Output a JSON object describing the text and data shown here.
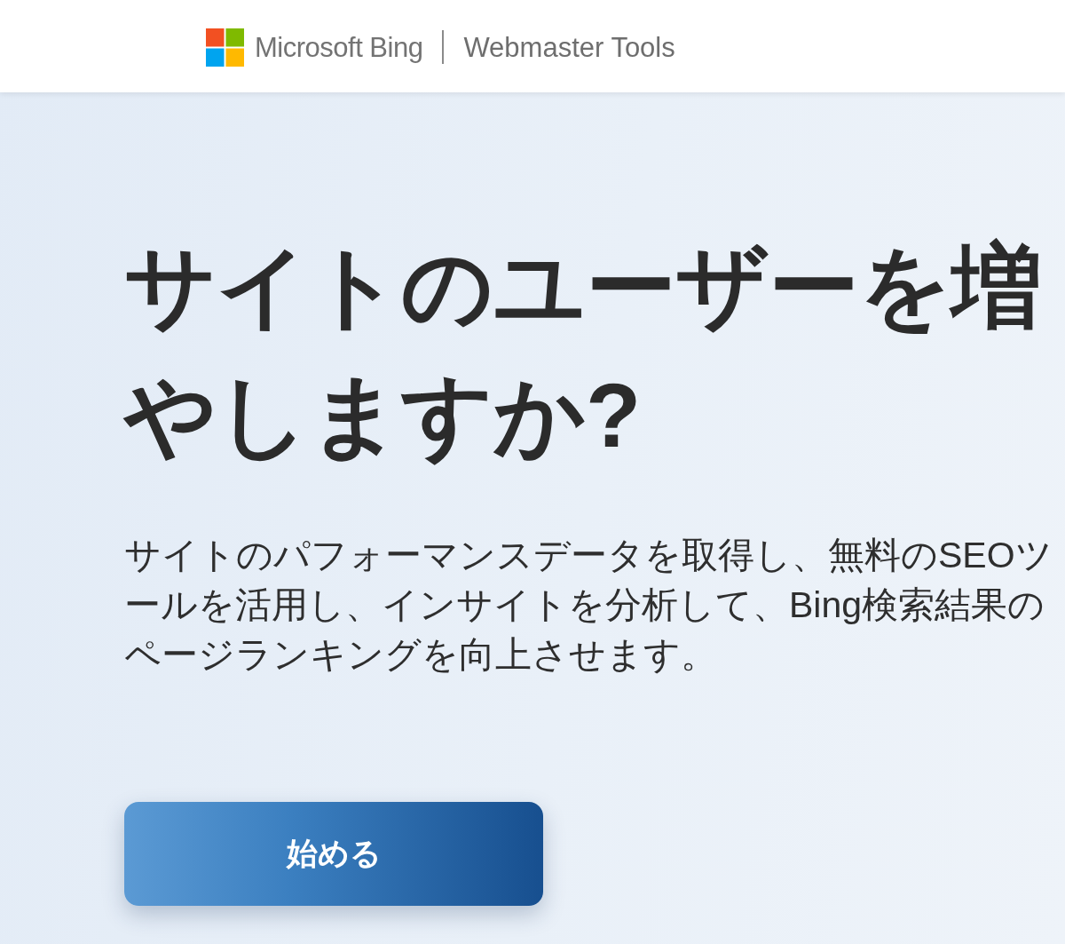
{
  "header": {
    "brand": "Microsoft Bing",
    "product": "Webmaster Tools"
  },
  "hero": {
    "heading": "サイトのユーザーを増やしますか?",
    "description": "サイトのパフォーマンスデータを取得し、無料のSEOツールを活用し、インサイトを分析して、Bing検索結果のページランキングを向上させます。",
    "button": "始める"
  }
}
